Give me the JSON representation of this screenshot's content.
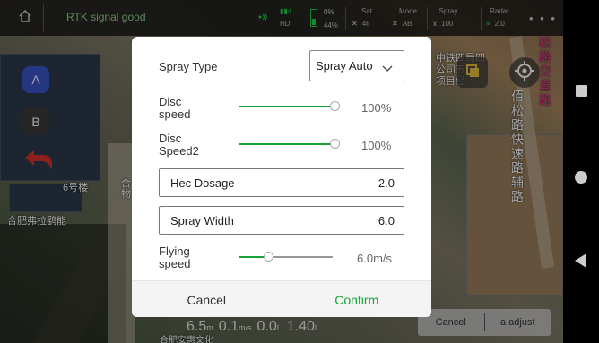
{
  "topbar": {
    "signal_text": "RTK signal good",
    "hd_label": "HD",
    "battery_pct_top": "0%",
    "battery_pct_bottom": "44%",
    "sat_header": "Sat",
    "sat_value": "46",
    "mode_header": "Mode",
    "mode_value": "AB",
    "spray_header": "Spray",
    "spray_value": "100",
    "radar_header": "Radar",
    "radar_value": "2.0",
    "more": "• • •"
  },
  "left_controls": {
    "a_label": "A",
    "b_label": "B"
  },
  "map_labels": {
    "building": "6号楼",
    "company": "合肥弗拉鹞能",
    "vertical_road": "松路交直路",
    "vertical_road2": "佰松路快速路辅路",
    "partial_a": "中铁四局四",
    "partial_b": "公司五",
    "partial_c": "项目经",
    "side": "合",
    "side2": "物",
    "bottom": "合肥安惠文化"
  },
  "bottom": {
    "stat1": "6.5",
    "stat1_unit": "m",
    "stat2": "0.1",
    "stat2_unit": "m/s",
    "stat3": "0.0",
    "stat3_unit": "L",
    "stat4": "1.40",
    "stat4_unit": "L",
    "cancel_label": "Cancel",
    "adjust_label": "a adjust"
  },
  "dialog": {
    "spray_type_label": "Spray Type",
    "spray_type_value": "Spray Auto",
    "disc_speed_label_1": "Disc",
    "disc_speed_label_2": "speed",
    "disc_speed_value": "100%",
    "disc_speed_level": 1.0,
    "disc_speed2_label_1": "Disc",
    "disc_speed2_label_2": "Speed2",
    "disc_speed2_value": "100%",
    "disc_speed2_level": 1.0,
    "hec_dosage_label": "Hec Dosage",
    "hec_dosage_value": "2.0",
    "spray_width_label": "Spray Width",
    "spray_width_value": "6.0",
    "flying_speed_label_1": "Flying",
    "flying_speed_label_2": "speed",
    "flying_speed_value": "6.0m/s",
    "flying_speed_level": 0.29,
    "cancel_label": "Cancel",
    "confirm_label": "Confirm"
  },
  "colors": {
    "accent_green": "#1aa23a",
    "status_green": "#21d24b",
    "button_a_blue": "#3a55c8"
  }
}
